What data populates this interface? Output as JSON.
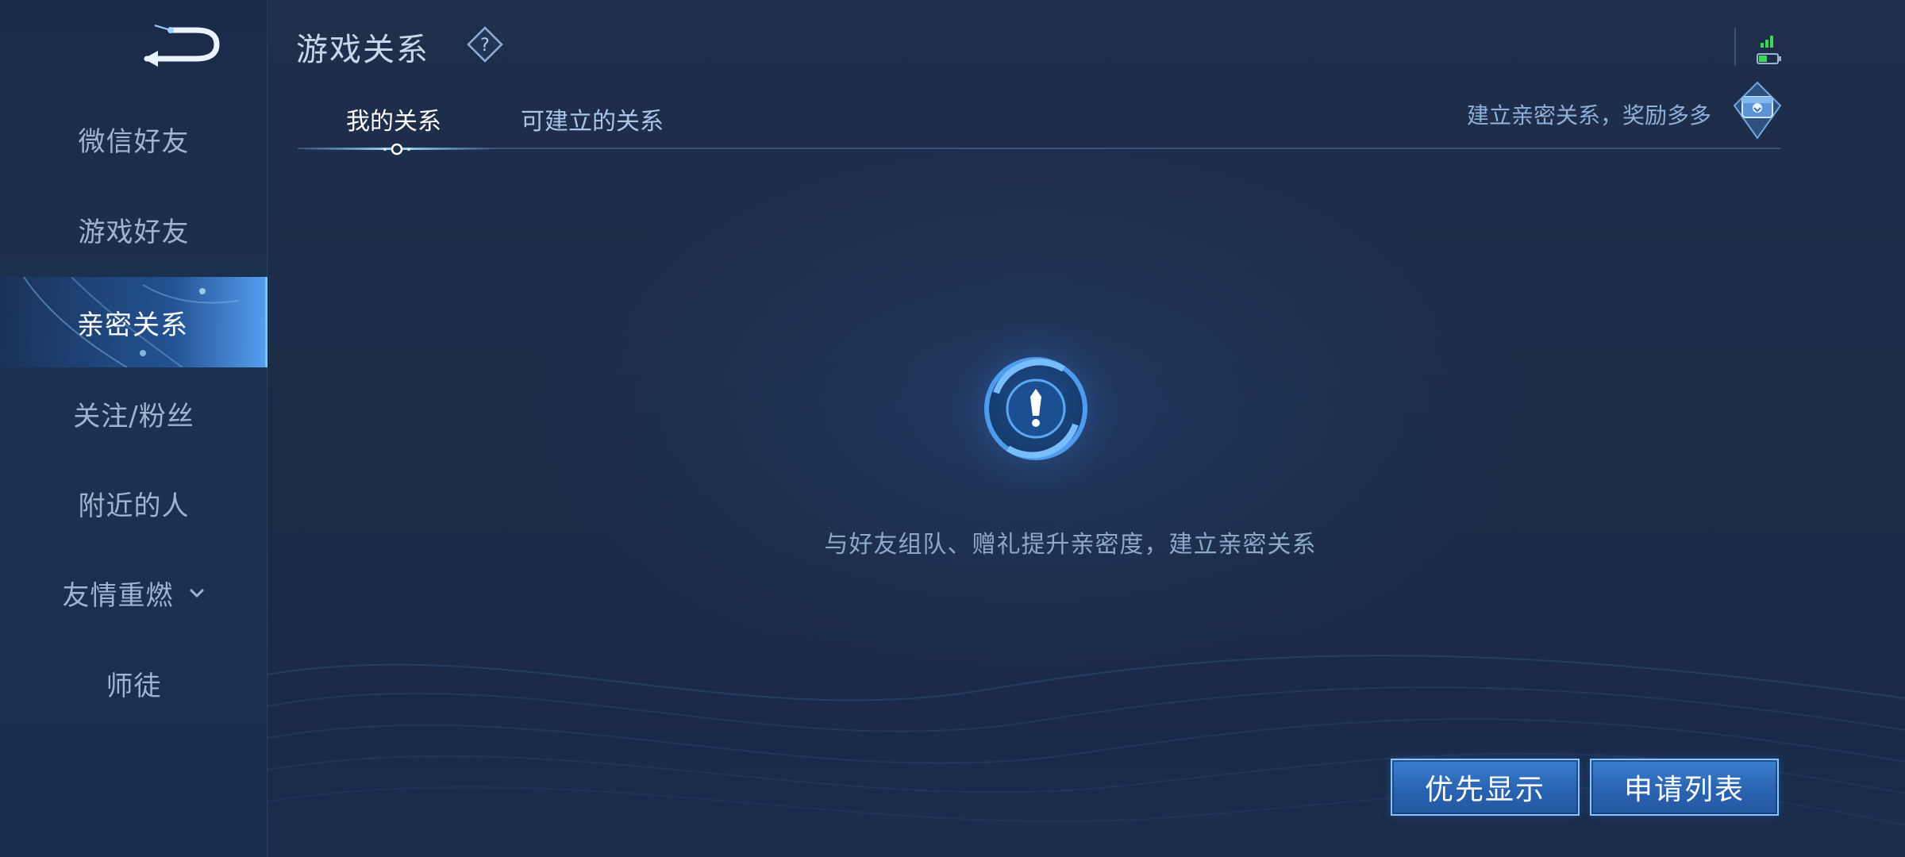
{
  "header": {
    "title": "游戏关系",
    "help_icon": "question-diamond-icon",
    "back_icon": "back-arrow-icon"
  },
  "sidebar": {
    "items": [
      {
        "label": "微信好友",
        "active": false
      },
      {
        "label": "游戏好友",
        "active": false
      },
      {
        "label": "亲密关系",
        "active": true
      },
      {
        "label": "关注/粉丝",
        "active": false
      },
      {
        "label": "附近的人",
        "active": false
      },
      {
        "label": "友情重燃",
        "active": false,
        "has_dropdown": true,
        "dropdown_icon": "chevron-down-icon"
      },
      {
        "label": "师徒",
        "active": false
      }
    ]
  },
  "tabs": [
    {
      "label": "我的关系",
      "active": true
    },
    {
      "label": "可建立的关系",
      "active": false
    }
  ],
  "promo": {
    "text": "建立亲密关系，奖励多多",
    "icon": "reward-chest-icon"
  },
  "empty_state": {
    "icon": "exclamation-emblem-icon",
    "message": "与好友组队、赠礼提升亲密度，建立亲密关系"
  },
  "buttons": {
    "priority_display": "优先显示",
    "application_list": "申请列表"
  },
  "status_bar": {
    "signal_icon": "signal-bars-icon",
    "battery_icon": "battery-icon"
  },
  "colors": {
    "accent": "#7cc4ff",
    "button_fill": "#2a63b1",
    "signal_green": "#3fd35a"
  }
}
